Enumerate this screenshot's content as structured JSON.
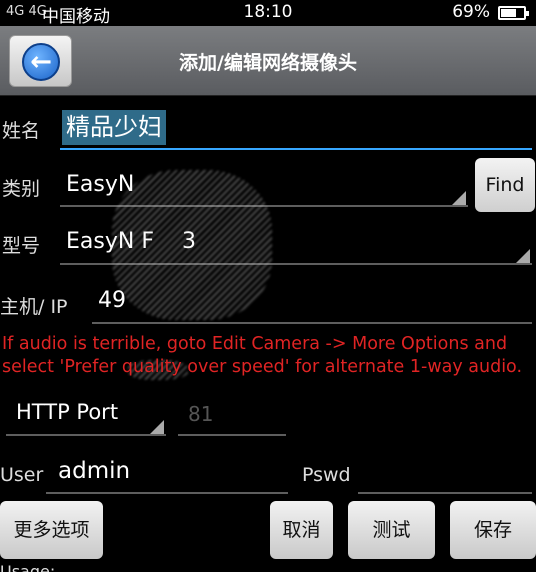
{
  "status_bar": {
    "signal": "4G 4G",
    "carrier": "中国移动",
    "time": "18:10",
    "battery_text": "69%",
    "battery_level": 0.69
  },
  "header": {
    "title": "添加/编辑网络摄像头",
    "back_icon": "back-arrow-icon"
  },
  "form": {
    "name": {
      "label": "姓名",
      "value": "精品少妇"
    },
    "category": {
      "label": "类别",
      "value": "EasyN",
      "find_label": "Find"
    },
    "model": {
      "label": "型号",
      "value": "EasyN F    3"
    },
    "host": {
      "label": "主机/ IP",
      "value": "49"
    },
    "warning": "If audio is terrible, goto Edit Camera -> More Options and select 'Prefer quality over speed' for alternate 1-way audio.",
    "port": {
      "label": "HTTP Port",
      "value": "81"
    },
    "user": {
      "label": "User",
      "value": "admin"
    },
    "pswd": {
      "label": "Pswd",
      "value": ""
    }
  },
  "buttons": {
    "more_options": "更多选项",
    "cancel": "取消",
    "test": "测试",
    "save": "保存"
  },
  "footer": {
    "usage": "Usage:"
  },
  "colors": {
    "accent": "#37a7ff",
    "warning": "#e02424",
    "highlight": "#2f6b89"
  }
}
